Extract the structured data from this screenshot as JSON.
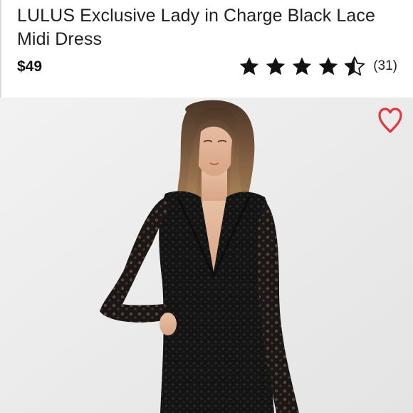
{
  "product": {
    "title": "LULUS Exclusive Lady in Charge Black Lace Midi Dress",
    "price": "$49",
    "rating": {
      "stars": 4.5,
      "max": 5,
      "count_label": "(31)"
    }
  },
  "image": {
    "subject": "product-photo",
    "favorite_icon": "heart-outline-icon"
  },
  "colors": {
    "accent_heart": "#e0383e",
    "text": "#1f1f1f",
    "photo_bg": "#ededed"
  }
}
